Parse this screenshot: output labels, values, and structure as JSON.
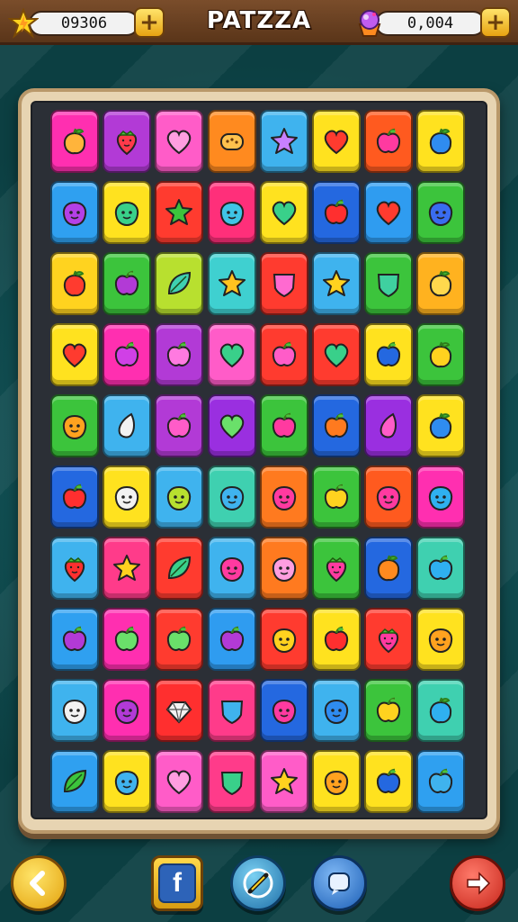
{
  "header": {
    "title": "PATZZA",
    "left_counter": {
      "value": "09306",
      "icon": "lightning-star-icon",
      "plus_label": "+"
    },
    "right_counter": {
      "value": "0,004",
      "icon": "gem-cupcake-icon",
      "plus_label": "+"
    }
  },
  "footer": {
    "back": {
      "icon": "chevron-left-icon"
    },
    "facebook": {
      "icon": "facebook-icon",
      "label": "f"
    },
    "tool": {
      "icon": "pencil-tool-icon"
    },
    "chat": {
      "icon": "chat-bubble-icon"
    },
    "next": {
      "icon": "arrow-right-icon"
    }
  },
  "board": {
    "rows": 10,
    "cols": 8,
    "tiles": [
      [
        {
          "bg": "#ff2fb0",
          "icon": "fruit",
          "c": "#ffb43b"
        },
        {
          "bg": "#b23ad6",
          "icon": "strawberry",
          "c": "#ff3a4a"
        },
        {
          "bg": "#ff5cc8",
          "icon": "heart",
          "c": "#ff9ee0"
        },
        {
          "bg": "#ff8a1f",
          "icon": "bean",
          "c": "#ffc24d"
        },
        {
          "bg": "#3fb3ee",
          "icon": "star",
          "c": "#c780ff"
        },
        {
          "bg": "#ffe21f",
          "icon": "heart",
          "c": "#ff3b2f"
        },
        {
          "bg": "#ff5a1f",
          "icon": "apple",
          "c": "#ff3aa0"
        },
        {
          "bg": "#ffe21f",
          "icon": "fruit",
          "c": "#2f8cf0"
        }
      ],
      [
        {
          "bg": "#2fa0f0",
          "icon": "face",
          "c": "#b440e6"
        },
        {
          "bg": "#ffe21f",
          "icon": "face",
          "c": "#39d08a"
        },
        {
          "bg": "#ff3b2f",
          "icon": "star",
          "c": "#3cc43c"
        },
        {
          "bg": "#ff2f7a",
          "icon": "face",
          "c": "#3fc4e6"
        },
        {
          "bg": "#ffe21f",
          "icon": "heart",
          "c": "#39d08a"
        },
        {
          "bg": "#2468e0",
          "icon": "apple",
          "c": "#ff2f2f"
        },
        {
          "bg": "#2f9cf0",
          "icon": "heart",
          "c": "#ff3b2f"
        },
        {
          "bg": "#3cc43c",
          "icon": "face",
          "c": "#3a6cf0"
        }
      ],
      [
        {
          "bg": "#ffd31f",
          "icon": "fruit",
          "c": "#ff3b2f"
        },
        {
          "bg": "#3cc43c",
          "icon": "apple",
          "c": "#b23ad6"
        },
        {
          "bg": "#b8e02f",
          "icon": "leaf",
          "c": "#3fd0b0"
        },
        {
          "bg": "#3fd0d0",
          "icon": "star",
          "c": "#ffc21f"
        },
        {
          "bg": "#ff3b2f",
          "icon": "shield",
          "c": "#ff6ad0"
        },
        {
          "bg": "#3fb3ee",
          "icon": "star",
          "c": "#ffd21f"
        },
        {
          "bg": "#3cc43c",
          "icon": "shield",
          "c": "#3fd0a0"
        },
        {
          "bg": "#ffb21f",
          "icon": "fruit",
          "c": "#ffd84d"
        }
      ],
      [
        {
          "bg": "#ffe21f",
          "icon": "heart",
          "c": "#ff3b2f"
        },
        {
          "bg": "#ff2fb0",
          "icon": "apple",
          "c": "#d040e6"
        },
        {
          "bg": "#b23ad6",
          "icon": "apple",
          "c": "#ff7ae0"
        },
        {
          "bg": "#ff5cc8",
          "icon": "heart",
          "c": "#39d08a"
        },
        {
          "bg": "#ff3b2f",
          "icon": "apple",
          "c": "#ff5cc8"
        },
        {
          "bg": "#ff3b2f",
          "icon": "heart",
          "c": "#39d08a"
        },
        {
          "bg": "#ffe21f",
          "icon": "apple",
          "c": "#2468e0"
        },
        {
          "bg": "#3cc43c",
          "icon": "fruit",
          "c": "#ffd21f"
        }
      ],
      [
        {
          "bg": "#3cc43c",
          "icon": "face",
          "c": "#ffa21f"
        },
        {
          "bg": "#3fb3ee",
          "icon": "drop",
          "c": "#f2f2f2"
        },
        {
          "bg": "#b23ad6",
          "icon": "apple",
          "c": "#ff5cc8"
        },
        {
          "bg": "#9a2fe0",
          "icon": "heart",
          "c": "#6ae06a"
        },
        {
          "bg": "#3cc43c",
          "icon": "apple",
          "c": "#ff3aa0"
        },
        {
          "bg": "#2468e0",
          "icon": "apple",
          "c": "#ff7a1f"
        },
        {
          "bg": "#9a2fe0",
          "icon": "drop",
          "c": "#ff5cc8"
        },
        {
          "bg": "#ffe21f",
          "icon": "fruit",
          "c": "#2f8cf0"
        }
      ],
      [
        {
          "bg": "#2468e0",
          "icon": "apple",
          "c": "#ff2f2f"
        },
        {
          "bg": "#ffe21f",
          "icon": "face",
          "c": "#f2f2f2"
        },
        {
          "bg": "#3fb3ee",
          "icon": "face",
          "c": "#b8e02f"
        },
        {
          "bg": "#3fd0b0",
          "icon": "face",
          "c": "#3fb3ee"
        },
        {
          "bg": "#ff7a1f",
          "icon": "face",
          "c": "#ff3aa0"
        },
        {
          "bg": "#3cc43c",
          "icon": "apple",
          "c": "#ffd21f"
        },
        {
          "bg": "#ff5a1f",
          "icon": "face",
          "c": "#ff3aa0"
        },
        {
          "bg": "#ff2fb0",
          "icon": "face",
          "c": "#2fb0f0"
        }
      ],
      [
        {
          "bg": "#3fb3ee",
          "icon": "strawberry",
          "c": "#ff2f2f"
        },
        {
          "bg": "#ff3b8a",
          "icon": "star",
          "c": "#ffd21f"
        },
        {
          "bg": "#ff3b2f",
          "icon": "leaf",
          "c": "#39d08a"
        },
        {
          "bg": "#3fb3ee",
          "icon": "face",
          "c": "#ff3aa0"
        },
        {
          "bg": "#ff7a1f",
          "icon": "face",
          "c": "#ff9ee0"
        },
        {
          "bg": "#3cc43c",
          "icon": "strawberry",
          "c": "#ff3aa0"
        },
        {
          "bg": "#2468e0",
          "icon": "fruit",
          "c": "#ff8a1f"
        },
        {
          "bg": "#3fd0b0",
          "icon": "apple",
          "c": "#2fb0f0"
        }
      ],
      [
        {
          "bg": "#2fa0f0",
          "icon": "apple",
          "c": "#b23ad6"
        },
        {
          "bg": "#ff2fb0",
          "icon": "apple",
          "c": "#6ae06a"
        },
        {
          "bg": "#ff3b2f",
          "icon": "apple",
          "c": "#6ae06a"
        },
        {
          "bg": "#2f9cf0",
          "icon": "apple",
          "c": "#b23ad6"
        },
        {
          "bg": "#ff3b2f",
          "icon": "face",
          "c": "#ffd21f"
        },
        {
          "bg": "#ffe21f",
          "icon": "apple",
          "c": "#ff2f2f"
        },
        {
          "bg": "#ff3b2f",
          "icon": "strawberry",
          "c": "#ff3aa0"
        },
        {
          "bg": "#ffe21f",
          "icon": "face",
          "c": "#ffa21f"
        }
      ],
      [
        {
          "bg": "#3fb3ee",
          "icon": "face",
          "c": "#f2f2f2"
        },
        {
          "bg": "#ff2fb0",
          "icon": "face",
          "c": "#b23ad6"
        },
        {
          "bg": "#ff2f2f",
          "icon": "diamond",
          "c": "#f2f2f2"
        },
        {
          "bg": "#ff3b8a",
          "icon": "shield",
          "c": "#3fb3ee"
        },
        {
          "bg": "#2468e0",
          "icon": "face",
          "c": "#ff3aa0"
        },
        {
          "bg": "#3fb3ee",
          "icon": "face",
          "c": "#2f8cf0"
        },
        {
          "bg": "#3cc43c",
          "icon": "apple",
          "c": "#ffd21f"
        },
        {
          "bg": "#3fd0b0",
          "icon": "fruit",
          "c": "#2fb0f0"
        }
      ],
      [
        {
          "bg": "#2fa0f0",
          "icon": "leaf",
          "c": "#3cc43c"
        },
        {
          "bg": "#ffe21f",
          "icon": "face",
          "c": "#3fb3ee"
        },
        {
          "bg": "#ff5cc8",
          "icon": "heart",
          "c": "#ff9ee0"
        },
        {
          "bg": "#ff3b8a",
          "icon": "shield",
          "c": "#39d08a"
        },
        {
          "bg": "#ff5cc8",
          "icon": "star",
          "c": "#ffd21f"
        },
        {
          "bg": "#ffe21f",
          "icon": "face",
          "c": "#ffa21f"
        },
        {
          "bg": "#ffe21f",
          "icon": "apple",
          "c": "#2468e0"
        },
        {
          "bg": "#2fa0f0",
          "icon": "apple",
          "c": "#3fb3ee"
        }
      ]
    ]
  }
}
